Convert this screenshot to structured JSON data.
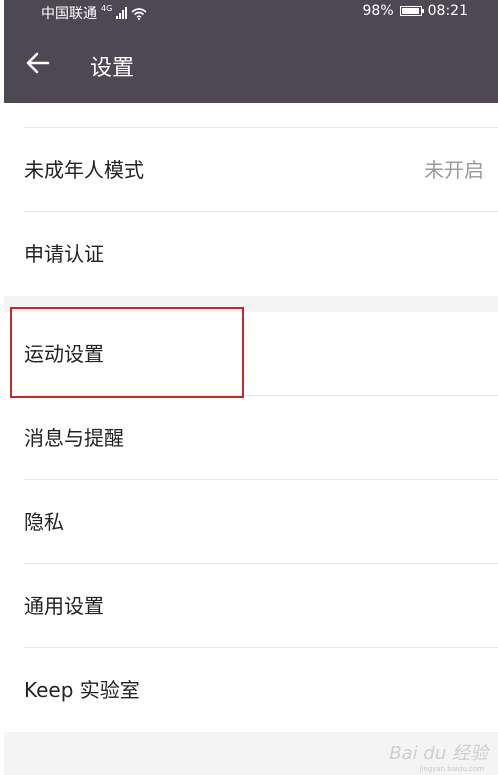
{
  "status_bar": {
    "carrier": "中国联通",
    "network_type": "4G",
    "battery_percent": "98%",
    "battery_level": 0.98,
    "time": "08:21",
    "icons": [
      "signal-icon",
      "wifi-icon",
      "battery-icon"
    ]
  },
  "header": {
    "title": "设置",
    "back_icon": "back-arrow-icon",
    "background_color": "#4e4754"
  },
  "settings": {
    "items": [
      {
        "label": "未成年人模式",
        "value": "未开启"
      },
      {
        "label": "申请认证"
      },
      {
        "label": "运动设置",
        "highlighted": true
      },
      {
        "label": "消息与提醒"
      },
      {
        "label": "隐私"
      },
      {
        "label": "通用设置"
      },
      {
        "label": "Keep 实验室"
      }
    ]
  },
  "annotation_color": "#c62828",
  "watermark": {
    "text": "Bai du 经验",
    "sub": "jingyan.baidu.com"
  }
}
